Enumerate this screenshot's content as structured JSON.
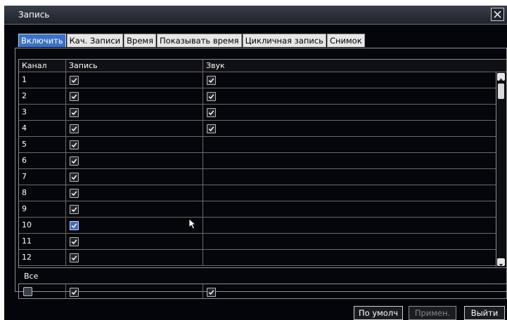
{
  "window": {
    "title": "Запись",
    "close_icon": "close-icon"
  },
  "tabs": [
    {
      "label": "Включить",
      "active": true
    },
    {
      "label": "Кач. Записи",
      "active": false
    },
    {
      "label": "Время",
      "active": false
    },
    {
      "label": "Показывать время",
      "active": false
    },
    {
      "label": "Цикличная запись",
      "active": false
    },
    {
      "label": "Снимок",
      "active": false
    }
  ],
  "table": {
    "headers": [
      "Канал",
      "Запись",
      "Звук"
    ],
    "rows": [
      {
        "channel": "1",
        "record": true,
        "audio": true
      },
      {
        "channel": "2",
        "record": true,
        "audio": true
      },
      {
        "channel": "3",
        "record": true,
        "audio": true
      },
      {
        "channel": "4",
        "record": true,
        "audio": true
      },
      {
        "channel": "5",
        "record": true,
        "audio": false
      },
      {
        "channel": "6",
        "record": true,
        "audio": false
      },
      {
        "channel": "7",
        "record": true,
        "audio": false
      },
      {
        "channel": "8",
        "record": true,
        "audio": false
      },
      {
        "channel": "9",
        "record": true,
        "audio": false
      },
      {
        "channel": "10",
        "record": true,
        "audio": false,
        "focused": true
      },
      {
        "channel": "11",
        "record": true,
        "audio": false
      },
      {
        "channel": "12",
        "record": true,
        "audio": false
      }
    ]
  },
  "all": {
    "label": "Все",
    "select_all": false,
    "record": true,
    "audio": true
  },
  "buttons": {
    "default": "По умолч",
    "apply": "Примен.",
    "exit": "Выйти"
  },
  "colors": {
    "accent": "#3c72c4",
    "background": "#04050b"
  }
}
